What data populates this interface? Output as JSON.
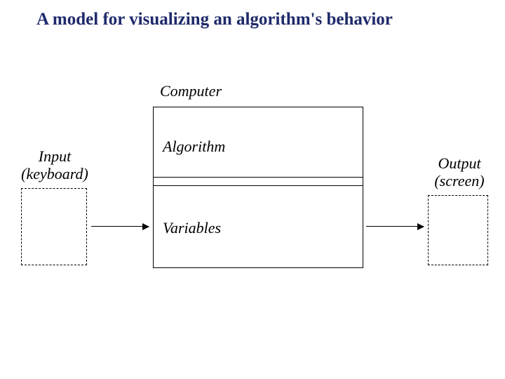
{
  "title": "A model for visualizing an algorithm's behavior",
  "labels": {
    "computer": "Computer",
    "algorithm": "Algorithm",
    "variables": "Variables",
    "input_l1": "Input",
    "input_l2": "(keyboard)",
    "output_l1": "Output",
    "output_l2": "(screen)"
  }
}
